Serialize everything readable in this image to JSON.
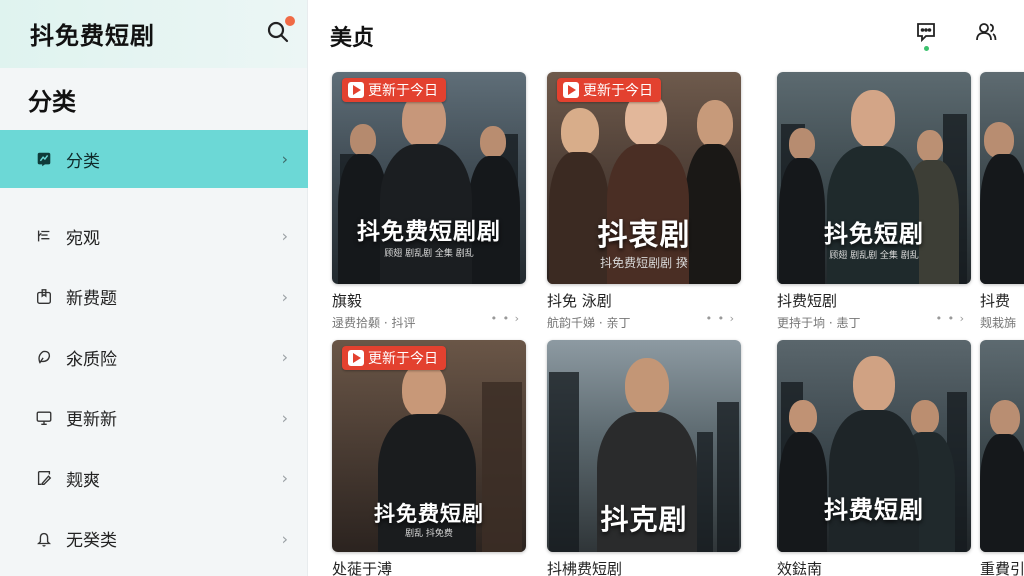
{
  "app": {
    "title": "抖免费短剧"
  },
  "sidebar": {
    "section_title": "分类",
    "items": [
      {
        "label": "分类",
        "icon": "category-icon",
        "active": true
      },
      {
        "label": "宛观",
        "icon": "list-icon"
      },
      {
        "label": "新费题",
        "icon": "bookmark-icon"
      },
      {
        "label": "氽质险",
        "icon": "leaf-icon"
      },
      {
        "label": "更新新",
        "icon": "tv-icon"
      },
      {
        "label": "觌爽",
        "icon": "edit-icon"
      },
      {
        "label": "无癸类",
        "icon": "bell-icon"
      }
    ]
  },
  "header": {
    "title": "美贞"
  },
  "badge_text": "更新于今日",
  "cards": [
    {
      "poster_title": "抖免费短剧剧",
      "poster_sub": "顾翅 剧乱剧 全集 剧乱",
      "title": "旗毅",
      "meta": "逯费拾颡 · 抖评",
      "more": "• • ›",
      "badge": true
    },
    {
      "poster_title": "抖衷剧",
      "poster_sub": "抖免费短剧剧 揆",
      "title": "抖免 泳剧",
      "meta": "航韵千娣 · 亲丁",
      "more": "• • ›",
      "badge": true
    },
    {
      "poster_title": "抖免短剧",
      "poster_sub": "顾翅 剧乱剧 全集 剧乱",
      "title": "抖费短剧",
      "meta": "更持于垧 · 恚丁",
      "more": "• • ›",
      "badge": false
    },
    {
      "poster_title": "",
      "poster_sub": "",
      "title": "抖费",
      "meta": "觌栽旆",
      "more": "",
      "badge": false
    },
    {
      "poster_title": "抖免费短剧",
      "poster_sub": "剧乱 抖免费",
      "title": "处蓰于溥",
      "meta": "",
      "more": "• • ›",
      "badge": true
    },
    {
      "poster_title": "抖克剧",
      "poster_sub": "",
      "title": "抖柫费短剧",
      "meta": "",
      "more": "• • ›",
      "badge": false
    },
    {
      "poster_title": "抖费短剧",
      "poster_sub": "",
      "title": "效鍅南",
      "meta": "",
      "more": "• • ›",
      "badge": false
    },
    {
      "poster_title": "",
      "poster_sub": "",
      "title": "重費引",
      "meta": "",
      "more": "",
      "badge": false
    }
  ],
  "colors": {
    "accent": "#6cd8d6",
    "badge": "#e3412f",
    "notification": "#f06a45",
    "message_dot": "#3cc16d"
  }
}
